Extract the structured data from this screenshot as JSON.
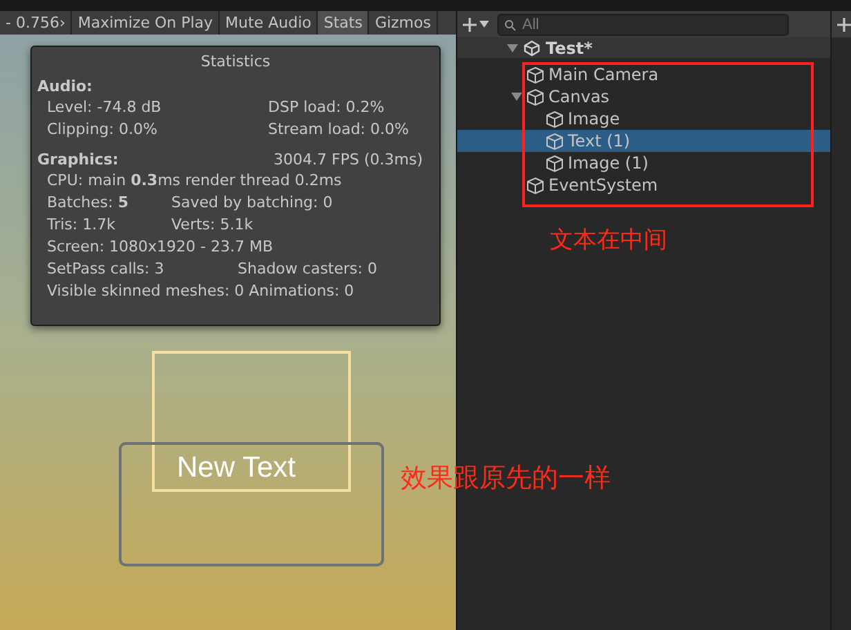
{
  "game_view": {
    "toolbar": [
      {
        "label": "- 0.756›",
        "selected": false
      },
      {
        "label": "Maximize On Play",
        "selected": false
      },
      {
        "label": "Mute Audio",
        "selected": false
      },
      {
        "label": "Stats",
        "selected": true
      },
      {
        "label": "Gizmos",
        "selected": false
      }
    ],
    "statistics": {
      "title": "Statistics",
      "sections": [
        {
          "heading": "Audio:",
          "rows": [
            {
              "kind": "audio",
              "cells": [
                "Level: -74.8 dB",
                "DSP load: 0.2%"
              ]
            },
            {
              "kind": "audio",
              "cells": [
                "Clipping: 0.0%",
                "Stream load: 0.0%"
              ]
            }
          ]
        },
        {
          "heading": "Graphics:",
          "aside": "3004.7 FPS (0.3ms)",
          "rows": [
            {
              "kind": "single",
              "cells": [
                "CPU: main **0.3**ms  render thread 0.2ms"
              ]
            },
            {
              "kind": "short",
              "cells": [
                "Batches: **5**",
                "Saved by batching: 0"
              ]
            },
            {
              "kind": "short",
              "cells": [
                "Tris: 1.7k",
                "Verts: 5.1k"
              ]
            },
            {
              "kind": "single",
              "cells": [
                "Screen: 1080x1920 - 23.7 MB"
              ]
            },
            {
              "kind": "long",
              "cells": [
                "SetPass calls: 3",
                "Shadow casters: 0"
              ]
            },
            {
              "kind": "single",
              "cells": [
                "Visible skinned meshes: 0  Animations: 0"
              ]
            }
          ]
        }
      ]
    },
    "scene_text": "New Text"
  },
  "hierarchy": {
    "search": {
      "placeholder": "All"
    },
    "scene": {
      "label": "Test*",
      "expanded": true,
      "children": [
        {
          "label": "Main Camera",
          "selected": false
        },
        {
          "label": "Canvas",
          "selected": false,
          "expanded": true,
          "children": [
            {
              "label": "Image",
              "selected": false
            },
            {
              "label": "Text (1)",
              "selected": true
            },
            {
              "label": "Image (1)",
              "selected": false
            }
          ]
        },
        {
          "label": "EventSystem",
          "selected": false
        }
      ]
    }
  },
  "annotations": [
    {
      "text": "文本在中间"
    },
    {
      "text": "效果跟原先的一样"
    }
  ]
}
